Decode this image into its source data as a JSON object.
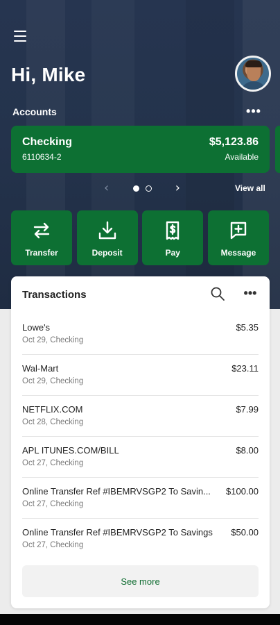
{
  "header": {
    "greeting": "Hi, Mike",
    "menu_icon": "hamburger-menu-icon",
    "avatar_icon": "user-avatar"
  },
  "accounts": {
    "section_label": "Accounts",
    "more_label": "•••",
    "card": {
      "name": "Checking",
      "number": "6110634-2",
      "balance": "$5,123.86",
      "balance_label": "Available"
    },
    "pager": {
      "prev": "‹",
      "next": "›",
      "current_page": 1,
      "total_pages": 2
    },
    "view_all": "View all"
  },
  "quick_actions": [
    {
      "label": "Transfer",
      "icon": "transfer-arrows-icon"
    },
    {
      "label": "Deposit",
      "icon": "download-tray-icon"
    },
    {
      "label": "Pay",
      "icon": "dollar-bill-icon"
    },
    {
      "label": "Message",
      "icon": "message-plus-icon"
    }
  ],
  "transactions": {
    "title": "Transactions",
    "more_label": "•••",
    "items": [
      {
        "merchant": "Lowe's",
        "meta": "Oct 29, Checking",
        "amount": "$5.35"
      },
      {
        "merchant": "Wal-Mart",
        "meta": "Oct 29, Checking",
        "amount": "$23.11"
      },
      {
        "merchant": "NETFLIX.COM",
        "meta": "Oct 28, Checking",
        "amount": "$7.99"
      },
      {
        "merchant": "APL ITUNES.COM/BILL",
        "meta": "Oct 27, Checking",
        "amount": "$8.00"
      },
      {
        "merchant": "Online Transfer Ref #IBEMRVSGP2 To Savin...",
        "meta": "Oct 27, Checking",
        "amount": "$100.00"
      },
      {
        "merchant": "Online Transfer Ref #IBEMRVSGP2 To Savings",
        "meta": "Oct 27, Checking",
        "amount": "$50.00"
      }
    ],
    "see_more": "See more"
  },
  "colors": {
    "brand_green": "#0d7033",
    "hero_navy": "#24334c",
    "link_green": "#0d6b2f"
  }
}
